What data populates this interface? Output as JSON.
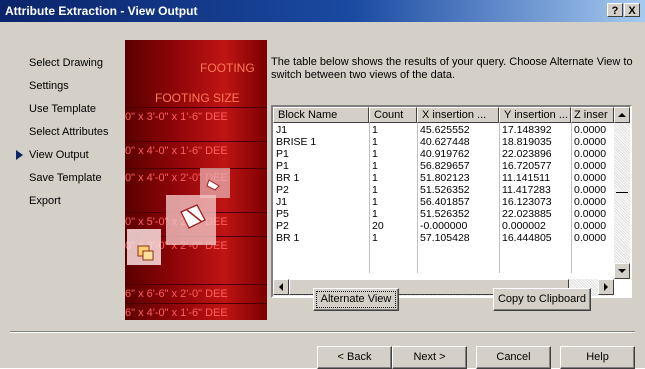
{
  "window": {
    "title": "Attribute Extraction - View Output",
    "help_button": "?",
    "close_button": "X"
  },
  "steps": [
    {
      "label": "Select Drawing",
      "current": false
    },
    {
      "label": "Settings",
      "current": false
    },
    {
      "label": "Use Template",
      "current": false
    },
    {
      "label": "Select Attributes",
      "current": false
    },
    {
      "label": "View Output",
      "current": true
    },
    {
      "label": "Save Template",
      "current": false
    },
    {
      "label": "Export",
      "current": false
    }
  ],
  "artwork": {
    "heading_top": "FOOTING",
    "heading_size": "FOOTING SIZE",
    "strips": [
      "0\" x 3'-0\" x 1'-6\" DEE",
      "0\" x 4'-0\" x 1'-6\" DEE",
      "0\" x 4'-0\" x 2'-0\" DEE",
      "0\" x 5'-0\" x 2'-6\" DEE",
      "0\" x 3'-0\" x 2'-0\" DEE",
      "6\" x 6'-6\" x 2'-0\" DEE",
      "6\" x 4'-0\" x 1'-6\" DEE"
    ]
  },
  "intro_text": "The table below shows the results of your query. Choose Alternate View to switch between two views of the data.",
  "table": {
    "columns": [
      "Block Name",
      "Count",
      "X insertion ...",
      "Y insertion ...",
      "Z inser"
    ],
    "rows": [
      [
        "J1",
        "1",
        "45.625552",
        "17.148392",
        "0.0000"
      ],
      [
        "BRISE 1",
        "1",
        "40.627448",
        "18.819035",
        "0.0000"
      ],
      [
        "P1",
        "1",
        "40.919762",
        "22.023896",
        "0.0000"
      ],
      [
        "P1",
        "1",
        "56.829657",
        "16.720577",
        "0.0000"
      ],
      [
        "BR 1",
        "1",
        "51.802123",
        "11.141511",
        "0.0000"
      ],
      [
        "P2",
        "1",
        "51.526352",
        "11.417283",
        "0.0000"
      ],
      [
        "J1",
        "1",
        "56.401857",
        "16.123073",
        "0.0000"
      ],
      [
        "P5",
        "1",
        "51.526352",
        "22.023885",
        "0.0000"
      ],
      [
        "P2",
        "20",
        "-0.000000",
        "0.000002",
        "0.0000"
      ],
      [
        "BR 1",
        "1",
        "57.105428",
        "16.444805",
        "0.0000"
      ]
    ]
  },
  "buttons": {
    "alternate_view": "Alternate View",
    "copy_clipboard": "Copy to Clipboard",
    "back": "< Back",
    "next": "Next >",
    "cancel": "Cancel",
    "help": "Help"
  },
  "icons": {
    "nav_arrow": "triangle-right",
    "sort_arrow": "triangle-up",
    "vertical_scroll": "scroll-arrows",
    "horizontal_scroll": "scroll-arrows"
  }
}
